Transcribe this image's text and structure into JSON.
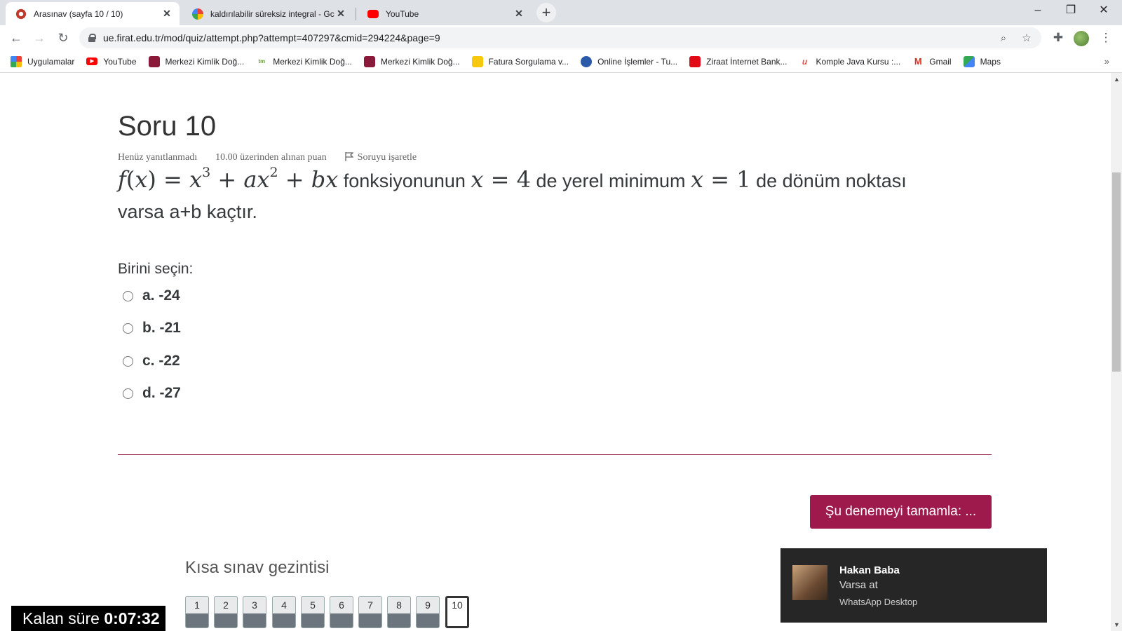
{
  "browser": {
    "tabs": [
      {
        "title": "Arasınav (sayfa 10 / 10)",
        "active": true
      },
      {
        "title": "kaldırılabilir süreksiz integral - Gc",
        "active": false
      },
      {
        "title": "YouTube",
        "active": false
      }
    ],
    "new_tab_label": "+",
    "url": "ue.firat.edu.tr/mod/quiz/attempt.php?attempt=407297&cmid=294224&page=9",
    "bookmarks": [
      "Uygulamalar",
      "YouTube",
      "Merkezi Kimlik Doğ...",
      "Merkezi Kimlik Doğ...",
      "Merkezi Kimlik Doğ...",
      "Fatura Sorgulama v...",
      "Online İşlemler - Tu...",
      "Ziraat İnternet Bank...",
      "Komple Java Kursu :...",
      "Gmail",
      "Maps"
    ],
    "bookmarks_more": "»"
  },
  "question": {
    "title": "Soru 10",
    "status": "Henüz yanıtlanmadı",
    "points": "10.00 üzerinden alınan puan",
    "flag_label": "Soruyu işaretle",
    "text_1": "fonksiyonunun",
    "text_2": "de yerel minimum",
    "text_3": "de dönüm noktası",
    "text_4": "varsa a+b kaçtır.",
    "prompt": "Birini seçin:",
    "answers": [
      "a. -24",
      "b. -21",
      "c. -22",
      "d. -27"
    ]
  },
  "finish_button": "Şu denemeyi tamamla: ...",
  "quiz_nav": {
    "title": "Kısa sınav gezintisi",
    "pages": [
      "1",
      "2",
      "3",
      "4",
      "5",
      "6",
      "7",
      "8",
      "9",
      "10"
    ],
    "current": "10"
  },
  "timer": {
    "label": "Kalan süre",
    "value": "0:07:32"
  },
  "notification": {
    "name": "Hakan Baba",
    "message": "Varsa at",
    "app": "WhatsApp Desktop"
  },
  "colors": {
    "accent": "#9f1a4c",
    "divider": "#8f1d44"
  }
}
